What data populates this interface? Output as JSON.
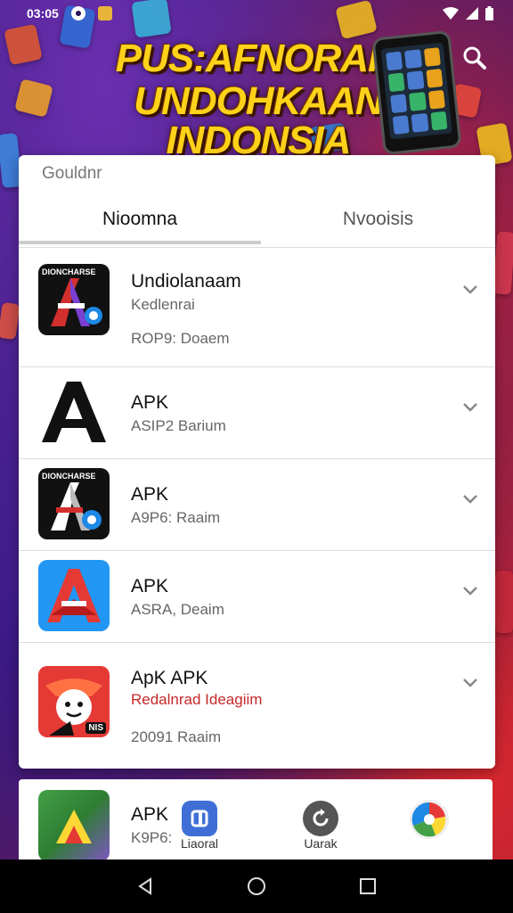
{
  "status_bar": {
    "time": "03:05"
  },
  "banner": {
    "line1": "PUS:AFNORAI?",
    "line2": "UNDOHKAAN INDONSIA"
  },
  "card": {
    "title": "Gouldnr",
    "tabs": [
      {
        "label": "Nioomna"
      },
      {
        "label": "Nvooisis"
      }
    ]
  },
  "apps": [
    {
      "name": "Undiolanaam",
      "subtitle": "Kedlenrai",
      "meta": "ROP9: Doaem",
      "icon": "app-icon-dark-a-badge",
      "icon_banner": "DIONCHARSE"
    },
    {
      "name": "APK",
      "subtitle": "",
      "meta": "ASIP2 Barium",
      "icon": "app-icon-black-a"
    },
    {
      "name": "APK",
      "subtitle": "",
      "meta": "A9P6: Raaim",
      "icon": "app-icon-dark-a-badge",
      "icon_banner": "DIONCHARSE"
    },
    {
      "name": "APK",
      "subtitle": "",
      "meta": "ASRA, Deaim",
      "icon": "app-icon-blue-a"
    },
    {
      "name": "ApK APK",
      "subtitle": "Redalnrad Ideagiim",
      "meta": "20091 Raaim",
      "icon": "app-icon-cartoon-face",
      "icon_badge": "NIS"
    }
  ],
  "bottom_row": {
    "name": "APK",
    "meta": "K9P6:",
    "icon": "app-icon-green-triangle"
  },
  "dock": [
    {
      "label": "Liaoral",
      "icon": "blue-app-icon"
    },
    {
      "label": "Uarak",
      "icon": "refresh-icon"
    },
    {
      "label": "",
      "icon": "colorful-pinwheel-icon"
    }
  ],
  "colors": {
    "headline": "#ffd21a",
    "accent_red": "#c0243c",
    "card_bg": "#ffffff",
    "subtitle_red": "#c62828"
  }
}
